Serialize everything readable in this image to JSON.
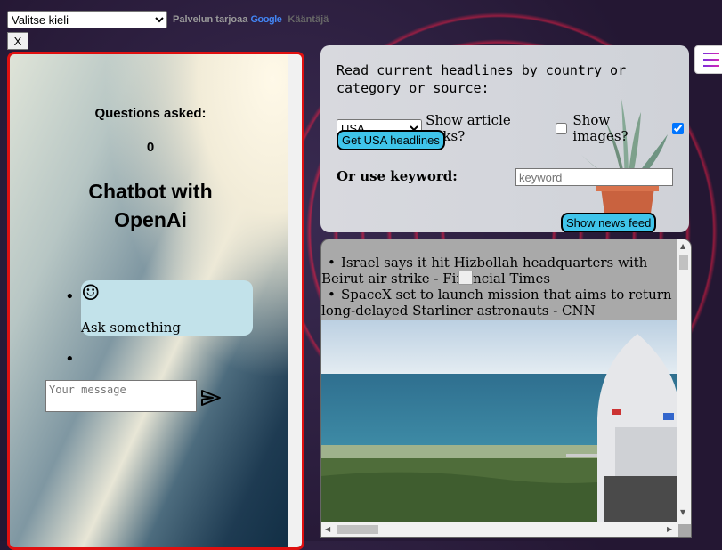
{
  "translate": {
    "language_select": "Valitse kieli",
    "powered_by": "Palvelun tarjoaa",
    "google_logo": "Google",
    "translate_word": "Kääntäjä"
  },
  "close_button": "X",
  "chat": {
    "questions_label": "Questions asked:",
    "questions_count": "0",
    "title_line1": "Chatbot with",
    "title_line2": "OpenAi",
    "smile_glyph": "☺",
    "greeting": "Ask something",
    "message_placeholder": "Your message",
    "send_icon": "send-icon"
  },
  "news": {
    "headline": "Read current headlines by country or category or source:",
    "country_selected": "USA",
    "show_links_label": "Show article links?",
    "show_links_checked": false,
    "show_images_label": "Show images?",
    "show_images_checked": true,
    "get_button": "Get USA headlines",
    "keyword_label": "Or use keyword:",
    "keyword_placeholder": "keyword",
    "feed_button": "Show news feed"
  },
  "feed": {
    "items": [
      {
        "text": "Israel says it hit Hizbollah headquarters with Beirut air strike - Financial Times"
      },
      {
        "text": "SpaceX set to launch mission that aims to return long-delayed Starliner astronauts - CNN"
      }
    ]
  },
  "colors": {
    "accent_blue": "#3fc4ea",
    "panel_border_red": "#e01010",
    "bubble": "#c2e2ea"
  }
}
